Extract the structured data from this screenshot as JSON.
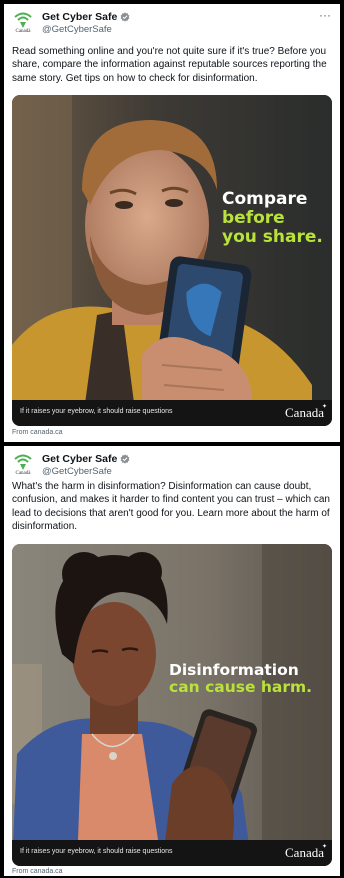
{
  "tweets": [
    {
      "account_name": "Get Cyber Safe",
      "handle": "@GetCyberSafe",
      "logo_caption": "Canadä",
      "text": "Read something online and you're not quite sure if it's true? Before you share, compare the information against reputable sources reporting the same story. Get tips on how to check for disinformation.",
      "headline_lines": [
        {
          "text": "Compare",
          "color": "white"
        },
        {
          "text": "before",
          "color": "green"
        },
        {
          "text": "you share.",
          "color": "green"
        }
      ],
      "media_caption": "If it raises your eyebrow, it should raise questions",
      "wordmark": "Canada",
      "source": "From canada.ca"
    },
    {
      "account_name": "Get Cyber Safe",
      "handle": "@GetCyberSafe",
      "logo_caption": "Canadä",
      "text": "What's the harm in disinformation? Disinformation can cause doubt, confusion, and makes it harder to find content you can trust – which can lead to decisions that aren't good for you. Learn more about the harm of disinformation.",
      "headline_lines": [
        {
          "text": "Disinformation",
          "color": "white"
        },
        {
          "text": "can cause harm.",
          "color": "green"
        }
      ],
      "media_caption": "If it raises your eyebrow, it should raise questions",
      "wordmark": "Canada",
      "source": "From canada.ca"
    }
  ],
  "icons": {
    "logo": "wifi-shield-icon",
    "verified": "verified-badge-icon",
    "more": "more-options-icon"
  },
  "colors": {
    "headline_green": "#b9e33a",
    "verified_blue": "#1d9bf0",
    "logo_green": "#4caf50"
  }
}
